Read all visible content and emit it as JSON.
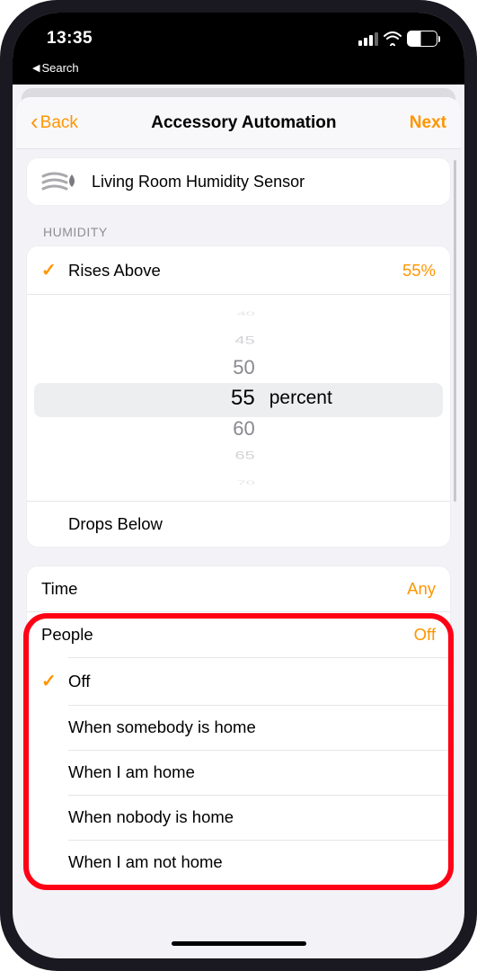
{
  "status": {
    "time": "13:35",
    "back_app": "Search",
    "battery": "45"
  },
  "nav": {
    "back": "Back",
    "title": "Accessory Automation",
    "next": "Next"
  },
  "sensor": {
    "name": "Living Room Humidity Sensor"
  },
  "humidity": {
    "section": "HUMIDITY",
    "rises_label": "Rises Above",
    "rises_value": "55%",
    "drops_label": "Drops Below",
    "unit": "percent",
    "picker": [
      "40",
      "45",
      "50",
      "55",
      "60",
      "65",
      "70"
    ],
    "selected_index": 3
  },
  "time_row": {
    "label": "Time",
    "value": "Any"
  },
  "people": {
    "label": "People",
    "value": "Off",
    "options": [
      {
        "label": "Off",
        "selected": true
      },
      {
        "label": "When somebody is home",
        "selected": false
      },
      {
        "label": "When I am home",
        "selected": false
      },
      {
        "label": "When nobody is home",
        "selected": false
      },
      {
        "label": "When I am not home",
        "selected": false
      }
    ]
  }
}
